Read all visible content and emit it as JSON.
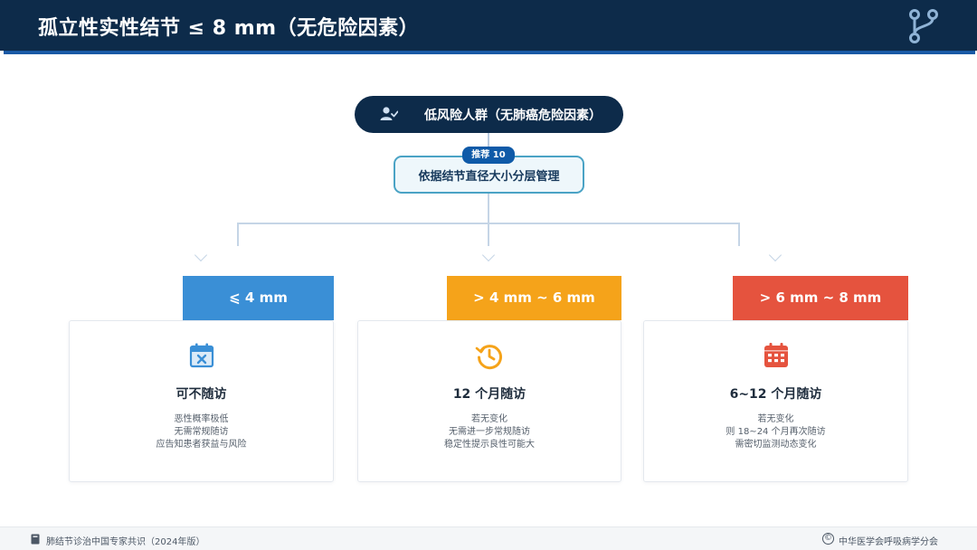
{
  "header": {
    "title": "孤立性实性结节 ≤ 8 mm（无危险因素）",
    "logo_icon": "branch-icon"
  },
  "top_node": {
    "icon": "user-check-icon",
    "label": "低风险人群（无肺癌危险因素）"
  },
  "recommendation": {
    "badge": "推荐 10",
    "label": "依据结节直径大小分层管理"
  },
  "categories": [
    {
      "header": "⩽ 4 mm",
      "color": "#3a8fd6",
      "icon": "calendar-x-icon",
      "title": "可不随访",
      "lines": [
        "恶性概率极低",
        "无需常规随访",
        "应告知患者获益与风险"
      ]
    },
    {
      "header": "> 4 mm ~ 6 mm",
      "color": "#f5a31a",
      "icon": "history-clock-icon",
      "title": "12 个月随访",
      "lines": [
        "若无变化",
        "无需进一步常规随访",
        "稳定性提示良性可能大"
      ]
    },
    {
      "header": "> 6 mm ~ 8 mm",
      "color": "#e5533e",
      "icon": "calendar-grid-icon",
      "title": "6~12 个月随访",
      "lines": [
        "若无变化",
        "则 18~24 个月再次随访",
        "需密切监测动态变化"
      ]
    }
  ],
  "footer": {
    "left": "肺结节诊治中国专家共识（2024年版）",
    "copyright_symbol": "©",
    "right": "中华医学会呼吸病学分会"
  }
}
